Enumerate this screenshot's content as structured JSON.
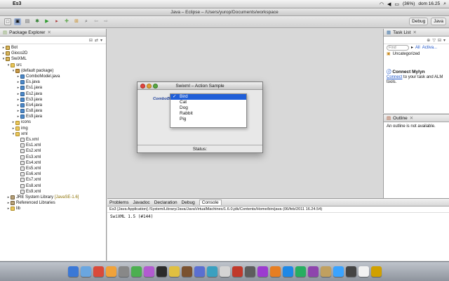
{
  "menubar": {
    "app_name": "Es3",
    "battery": "(36%)",
    "clock": "dom 16.25"
  },
  "window_title": "Java – Eclipse – /Users/yurop/Documents/workspace",
  "perspectives": {
    "debug": "Debug",
    "java": "Java"
  },
  "package_explorer": {
    "tab_label": "Package Explorer",
    "tree": [
      {
        "level": 0,
        "twisty": "▸",
        "icon": "proj",
        "label": "Bot"
      },
      {
        "level": 0,
        "twisty": "▸",
        "icon": "proj",
        "label": "Gioco2D"
      },
      {
        "level": 0,
        "twisty": "▾",
        "icon": "proj",
        "label": "SwiXML"
      },
      {
        "level": 1,
        "twisty": "▾",
        "icon": "folder",
        "label": "src"
      },
      {
        "level": 2,
        "twisty": "▾",
        "icon": "pkgi",
        "label": "(default package)"
      },
      {
        "level": 3,
        "twisty": "▸",
        "icon": "java",
        "label": "ComboModel.java"
      },
      {
        "level": 3,
        "twisty": "▸",
        "icon": "java",
        "label": "Es.java"
      },
      {
        "level": 3,
        "twisty": "▸",
        "icon": "java",
        "label": "Es1.java"
      },
      {
        "level": 3,
        "twisty": "▸",
        "icon": "java",
        "label": "Es2.java"
      },
      {
        "level": 3,
        "twisty": "▸",
        "icon": "java",
        "label": "Es3.java"
      },
      {
        "level": 3,
        "twisty": "▸",
        "icon": "java",
        "label": "Es4.java"
      },
      {
        "level": 3,
        "twisty": "▸",
        "icon": "java",
        "label": "Es8.java"
      },
      {
        "level": 3,
        "twisty": "▸",
        "icon": "java",
        "label": "Es9.java"
      },
      {
        "level": 2,
        "twisty": "▸",
        "icon": "folder",
        "label": "icons"
      },
      {
        "level": 2,
        "twisty": "▸",
        "icon": "folder",
        "label": "img"
      },
      {
        "level": 2,
        "twisty": "▾",
        "icon": "folder",
        "label": "xml"
      },
      {
        "level": 3,
        "twisty": "",
        "icon": "xml",
        "label": "Es.xml"
      },
      {
        "level": 3,
        "twisty": "",
        "icon": "xml",
        "label": "Es1.xml"
      },
      {
        "level": 3,
        "twisty": "",
        "icon": "xml",
        "label": "Es2.xml"
      },
      {
        "level": 3,
        "twisty": "",
        "icon": "xml",
        "label": "Es3.xml"
      },
      {
        "level": 3,
        "twisty": "",
        "icon": "xml",
        "label": "Es4.xml"
      },
      {
        "level": 3,
        "twisty": "",
        "icon": "xml",
        "label": "Es5.xml"
      },
      {
        "level": 3,
        "twisty": "",
        "icon": "xml",
        "label": "Es6.xml"
      },
      {
        "level": 3,
        "twisty": "",
        "icon": "xml",
        "label": "Es7.xml"
      },
      {
        "level": 3,
        "twisty": "",
        "icon": "xml",
        "label": "Es8.xml"
      },
      {
        "level": 3,
        "twisty": "",
        "icon": "xml",
        "label": "Es9.xml"
      },
      {
        "level": 1,
        "twisty": "▸",
        "icon": "lib",
        "label": "JRE System Library",
        "suffix": "[JavaSE-1.6]"
      },
      {
        "level": 1,
        "twisty": "▸",
        "icon": "lib",
        "label": "Referenced Libraries"
      },
      {
        "level": 1,
        "twisty": "▸",
        "icon": "folder",
        "label": "lib"
      }
    ]
  },
  "dialog": {
    "title": "Swixml – Action Sample",
    "combo_label": "ComboBox",
    "status": "Status:",
    "options": [
      {
        "label": "Bird",
        "selected": true
      },
      {
        "label": "Cat",
        "selected": false
      },
      {
        "label": "Dog",
        "selected": false
      },
      {
        "label": "Rabbit",
        "selected": false
      },
      {
        "label": "Pig",
        "selected": false
      }
    ]
  },
  "task_list": {
    "tab_label": "Task List",
    "find_placeholder": "Find",
    "all_label": "All",
    "activate_label": "Activa...",
    "uncategorized": "Uncategorized"
  },
  "mylyn": {
    "title": "Connect Mylyn",
    "link": "Connect",
    "text": " to your task and ALM tools."
  },
  "outline": {
    "tab_label": "Outline",
    "message": "An outline is not available."
  },
  "console": {
    "tabs": [
      "Problems",
      "Javadoc",
      "Declaration",
      "Debug",
      "Console"
    ],
    "path": "Es3 [Java Application] /System/Library/Java/JavaVirtualMachines/1.6.0.jdk/Contents/Home/bin/java (06/feb/2011 16.24.54)",
    "output": "SwiXML 1.5 (#144)"
  },
  "dock_colors": [
    "#3b78d6",
    "#6aa6e0",
    "#d94a3a",
    "#f0a23a",
    "#888888",
    "#4caf50",
    "#b25bd0",
    "#2b2b2b",
    "#e0c040",
    "#7a5230",
    "#5a6fd1",
    "#3aa0c0",
    "#d4d4d4",
    "#c0392b",
    "#5d5d5d",
    "#9c3bd0",
    "#e67e22",
    "#1e88e5",
    "#27ae60",
    "#8e44ad",
    "#c0a060",
    "#3aa3ff",
    "#444444",
    "#f2f2f2",
    "#d0a000"
  ]
}
